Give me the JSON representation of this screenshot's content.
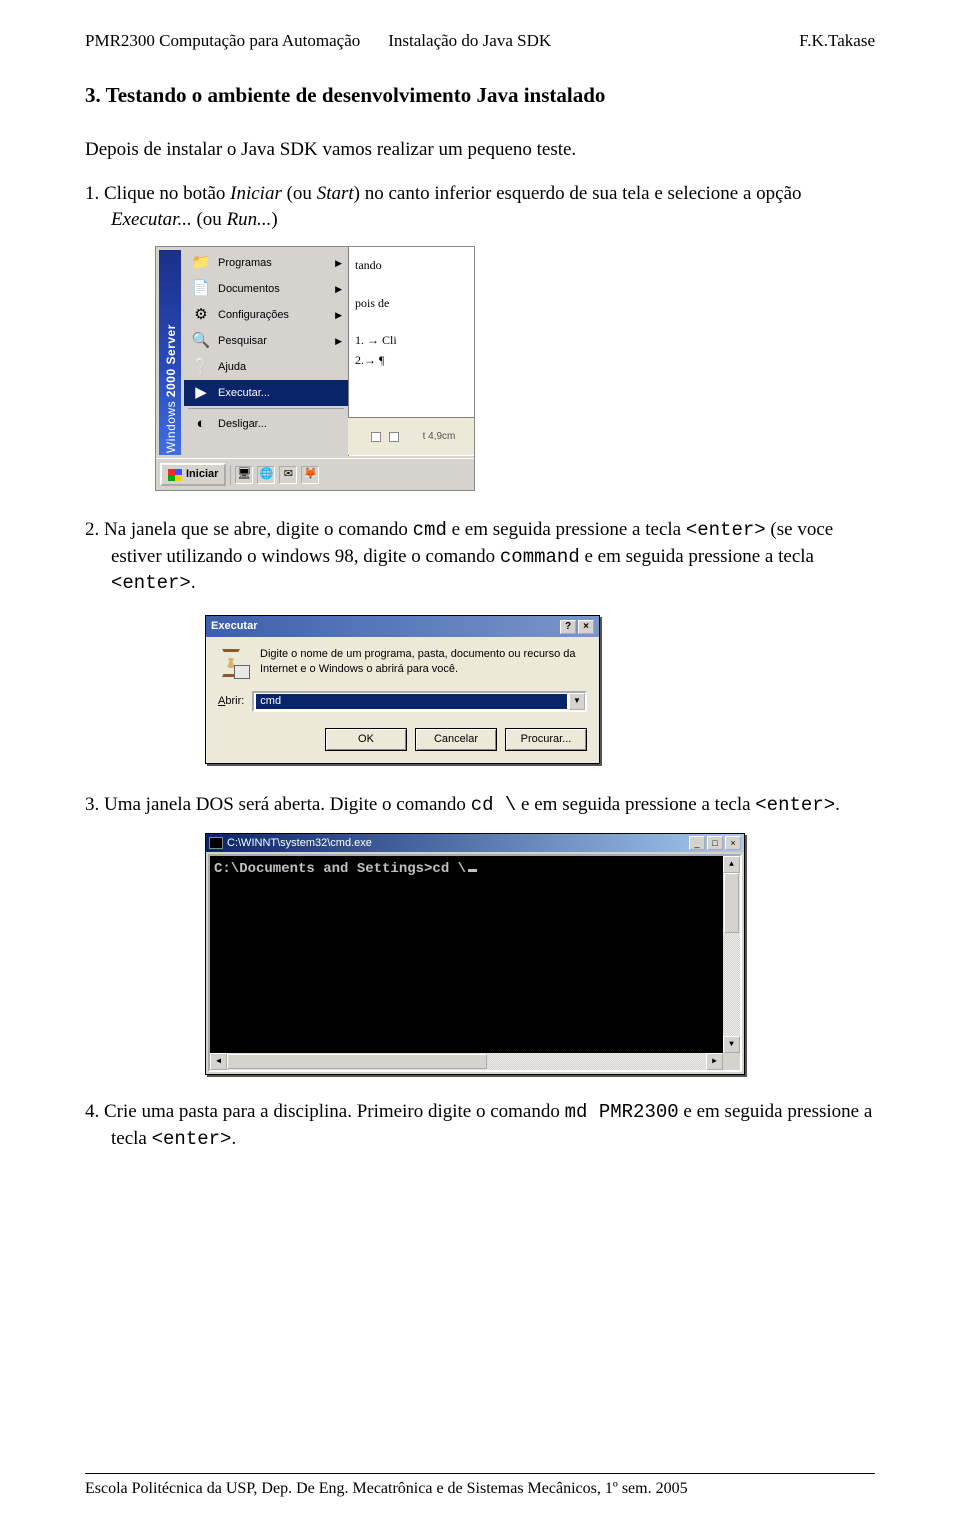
{
  "header": {
    "course": "PMR2300 Computação para Automação",
    "subject": "Instalação do Java SDK",
    "author": "F.K.Takase"
  },
  "section_title": "3. Testando o ambiente de desenvolvimento Java instalado",
  "intro_para": "Depois de instalar o Java SDK vamos realizar um pequeno teste.",
  "step1_prefix": "1. Clique no botão ",
  "step1_iniciar": "Iniciar",
  "step1_mid1": " (ou ",
  "step1_start": "Start",
  "step1_mid2": ") no canto inferior esquerdo de sua tela e selecione a opção ",
  "step1_exec": "Executar...",
  "step1_mid3": " (ou ",
  "step1_run": "Run...",
  "step1_end": ")",
  "startmenu": {
    "banner_prefix": "Windows",
    "banner_bold": "2000 Server",
    "items": [
      {
        "icon": "📁",
        "label": "Programas",
        "arrow": true
      },
      {
        "icon": "📄",
        "label": "Documentos",
        "arrow": true
      },
      {
        "icon": "⚙",
        "label": "Configurações",
        "arrow": true
      },
      {
        "icon": "🔍",
        "label": "Pesquisar",
        "arrow": true
      },
      {
        "icon": "❔",
        "label": "Ajuda",
        "arrow": false
      },
      {
        "icon": "▶",
        "label": "Executar...",
        "arrow": false,
        "hover": true
      },
      {
        "icon": "◐",
        "label": "Desligar...",
        "arrow": false
      }
    ],
    "right_fragments": [
      "tando",
      "pois de",
      "1. → Cli",
      "2.→ ¶"
    ],
    "ruler_text": "t 4,9cm",
    "start_label": "Iniciar"
  },
  "step2_prefix": "2. Na janela que se abre, digite o comando ",
  "step2_cmd": "cmd",
  "step2_mid1": " e em seguida pressione a tecla ",
  "step2_enter1": "<enter>",
  "step2_mid2": " (se voce estiver utilizando o windows 98, digite o comando ",
  "step2_command": "command",
  "step2_mid3": " e em seguida pressione a tecla ",
  "step2_enter2": "<enter>",
  "step2_end": ".",
  "rundialog": {
    "title": "Executar",
    "help_btn": "?",
    "close_btn": "×",
    "message": "Digite o nome de um programa, pasta, documento ou recurso da Internet e o Windows o abrirá para você.",
    "label": "Abrir:",
    "value": "cmd",
    "ok": "OK",
    "cancel": "Cancelar",
    "browse": "Procurar..."
  },
  "step3_prefix": "3. Uma janela DOS será aberta. Digite o comando ",
  "step3_cmd": "cd \\",
  "step3_mid": "  e em seguida pressione a tecla ",
  "step3_enter": "<enter>",
  "step3_end": ".",
  "cmdwin": {
    "title": "C:\\WINNT\\system32\\cmd.exe",
    "min": "_",
    "max": "□",
    "close": "×",
    "line1": "C:\\Documents and Settings>cd \\"
  },
  "step4_prefix": "4. Crie uma pasta para a disciplina. Primeiro digite o comando ",
  "step4_cmd": "md PMR2300",
  "step4_mid": " e em seguida pressione a tecla ",
  "step4_enter": "<enter>",
  "step4_end": ".",
  "footer_text": "Escola Politécnica da USP, Dep. De Eng. Mecatrônica e de Sistemas Mecânicos, 1º sem. 2005"
}
